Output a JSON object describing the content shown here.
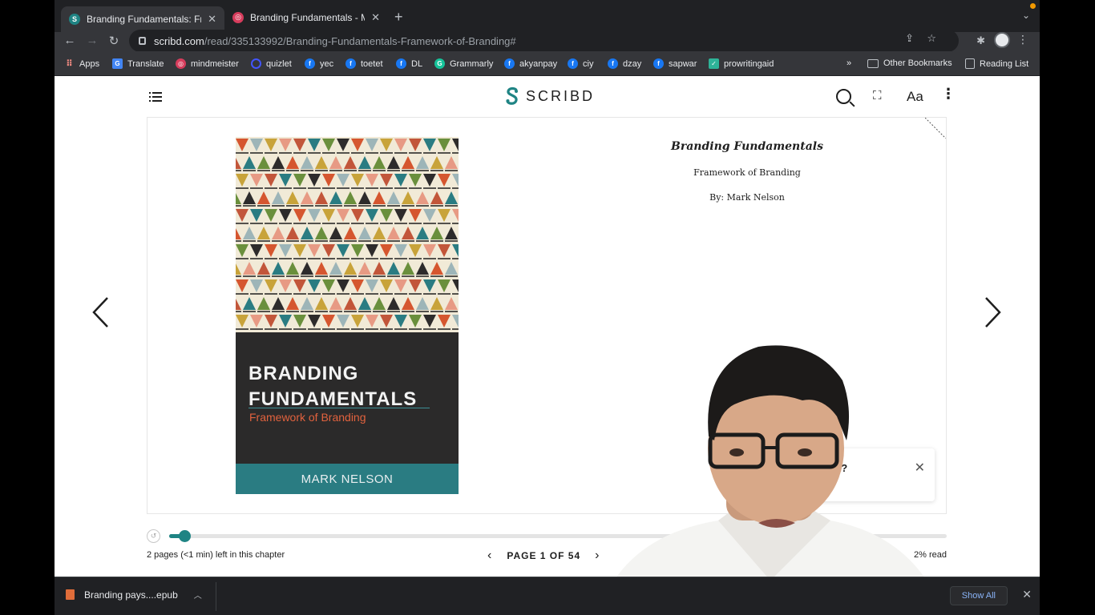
{
  "browser": {
    "tabs": [
      {
        "title": "Branding Fundamentals: Frame",
        "active": true,
        "favicon": "scribd-icon"
      },
      {
        "title": "Branding Fundamentals - Mind",
        "active": false,
        "favicon": "mindmeister-icon"
      }
    ],
    "url_host": "scribd.com",
    "url_path": "/read/335133992/Branding-Fundamentals-Framework-of-Branding#",
    "bookmarks": [
      {
        "label": "Apps",
        "icon": "apps-icon"
      },
      {
        "label": "Translate",
        "icon": "google-translate-icon"
      },
      {
        "label": "mindmeister",
        "icon": "mindmeister-icon"
      },
      {
        "label": "quizlet",
        "icon": "quizlet-icon"
      },
      {
        "label": "yec",
        "icon": "facebook-icon"
      },
      {
        "label": "toetet",
        "icon": "facebook-icon"
      },
      {
        "label": "DL",
        "icon": "facebook-icon"
      },
      {
        "label": "Grammarly",
        "icon": "grammarly-icon"
      },
      {
        "label": "akyanpay",
        "icon": "facebook-icon"
      },
      {
        "label": "ciy",
        "icon": "facebook-icon"
      },
      {
        "label": "dzay",
        "icon": "facebook-icon"
      },
      {
        "label": "sapwar",
        "icon": "facebook-icon"
      },
      {
        "label": "prowritingaid",
        "icon": "prowritingaid-icon"
      }
    ],
    "overflow_label": "»",
    "other_bookmarks": "Other Bookmarks",
    "reading_list": "Reading List"
  },
  "reader": {
    "logo_text": "SCRIBD",
    "cover": {
      "title_line1": "BRANDING",
      "title_line2": "FUNDAMENTALS",
      "subtitle": "Framework of Branding",
      "author": "MARK NELSON"
    },
    "title_page": {
      "title": "Branding Fundamentals",
      "subtitle": "Framework of Branding",
      "byline": "By: Mark Nelson"
    },
    "chapter_remaining": "2 pages (<1 min) left in this chapter",
    "page_indicator": "PAGE 1 OF 54",
    "percent_read": "2% read",
    "progress_fraction": 0.02,
    "popup_text": "k?",
    "colors": {
      "accent": "#1f8484",
      "cover_dark": "#2b2a2a",
      "cover_band": "#2a7c82",
      "cover_subtitle": "#e2623e"
    }
  },
  "downloads": {
    "file_name": "Branding pays....epub",
    "show_all": "Show All"
  }
}
